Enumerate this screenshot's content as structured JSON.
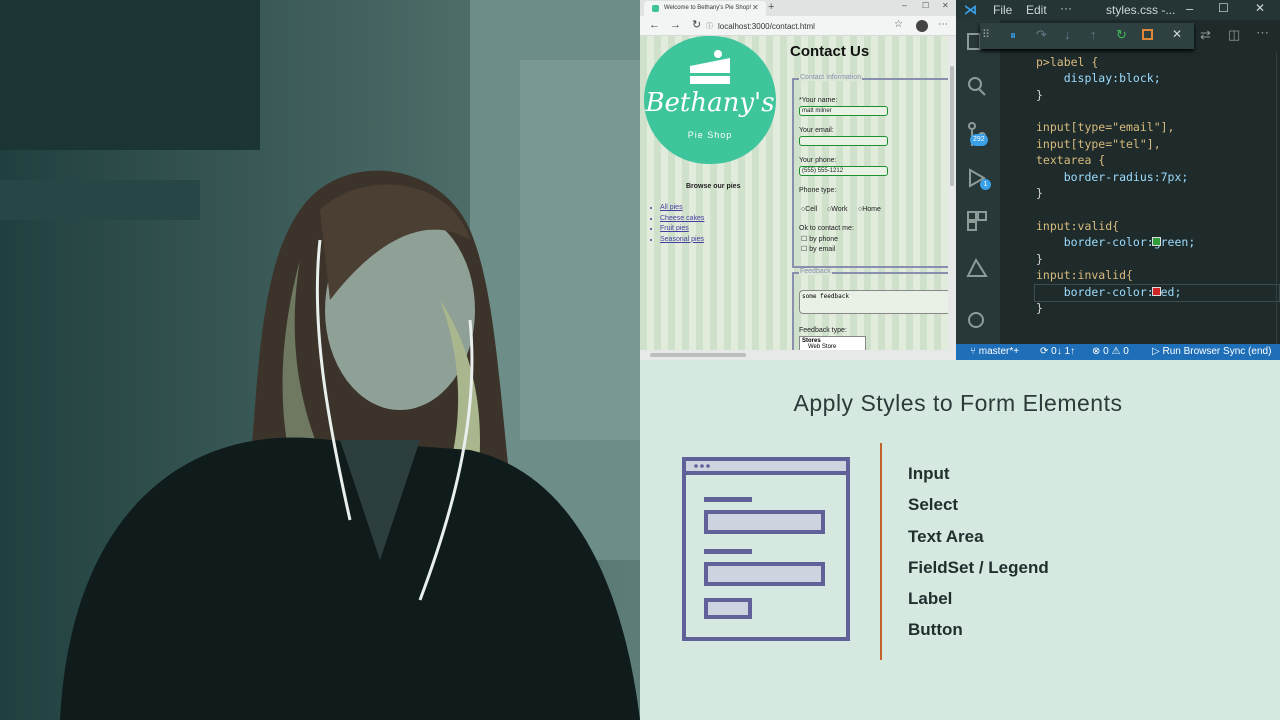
{
  "browser": {
    "tab_title": "Welcome to Bethany's Pie Shop!",
    "url": "localhost:3000/contact.html",
    "logo_line1": "Bethany's",
    "logo_line2": "Pie Shop",
    "heading": "Contact Us",
    "browse_heading": "Browse our pies",
    "pie_links": [
      "All pies",
      "Cheese cakes",
      "Fruit pies",
      "Seasonal pies"
    ],
    "legend_contact": "Contact Information",
    "label_name": "*Your name:",
    "value_name": "matt milner",
    "label_email": "Your email:",
    "label_phone": "Your phone:",
    "value_phone": "(555) 555-1212",
    "label_phone_type": "Phone type:",
    "phone_types": [
      "Cell",
      "Work",
      "Home"
    ],
    "label_ok_contact": "Ok to contact me:",
    "contact_options": [
      "by phone",
      "by email"
    ],
    "legend_feedback": "Feedback",
    "feedback_text": "some feedback",
    "label_feedback_type": "Feedback type:",
    "feedback_group": "Stores",
    "feedback_option": "Web Store"
  },
  "vscode": {
    "menu": [
      "File",
      "Edit",
      "···"
    ],
    "window_title": "styles.css -...",
    "code_lines": [
      "p>label {",
      "    display:block;",
      "}",
      "",
      "input[type=\"email\"],",
      "input[type=\"tel\"],",
      "textarea {",
      "    border-radius:7px;",
      "}",
      "",
      "input:valid{",
      "    border-color:green;",
      "}",
      "input:invalid{",
      "    border-color:red;",
      "}"
    ],
    "badge_scm": "292",
    "badge_debug": "1",
    "status_branch": "master*+",
    "status_sync": "0↓ 1↑",
    "status_problems": "0 ⚠ 0",
    "status_run": "Run Browser Sync (end)"
  },
  "slide": {
    "title": "Apply Styles to Form Elements",
    "items": [
      "Input",
      "Select",
      "Text Area",
      "FieldSet / Legend",
      "Label",
      "Button"
    ],
    "accent": "#c0622a",
    "icon_color": "#5f6198"
  }
}
